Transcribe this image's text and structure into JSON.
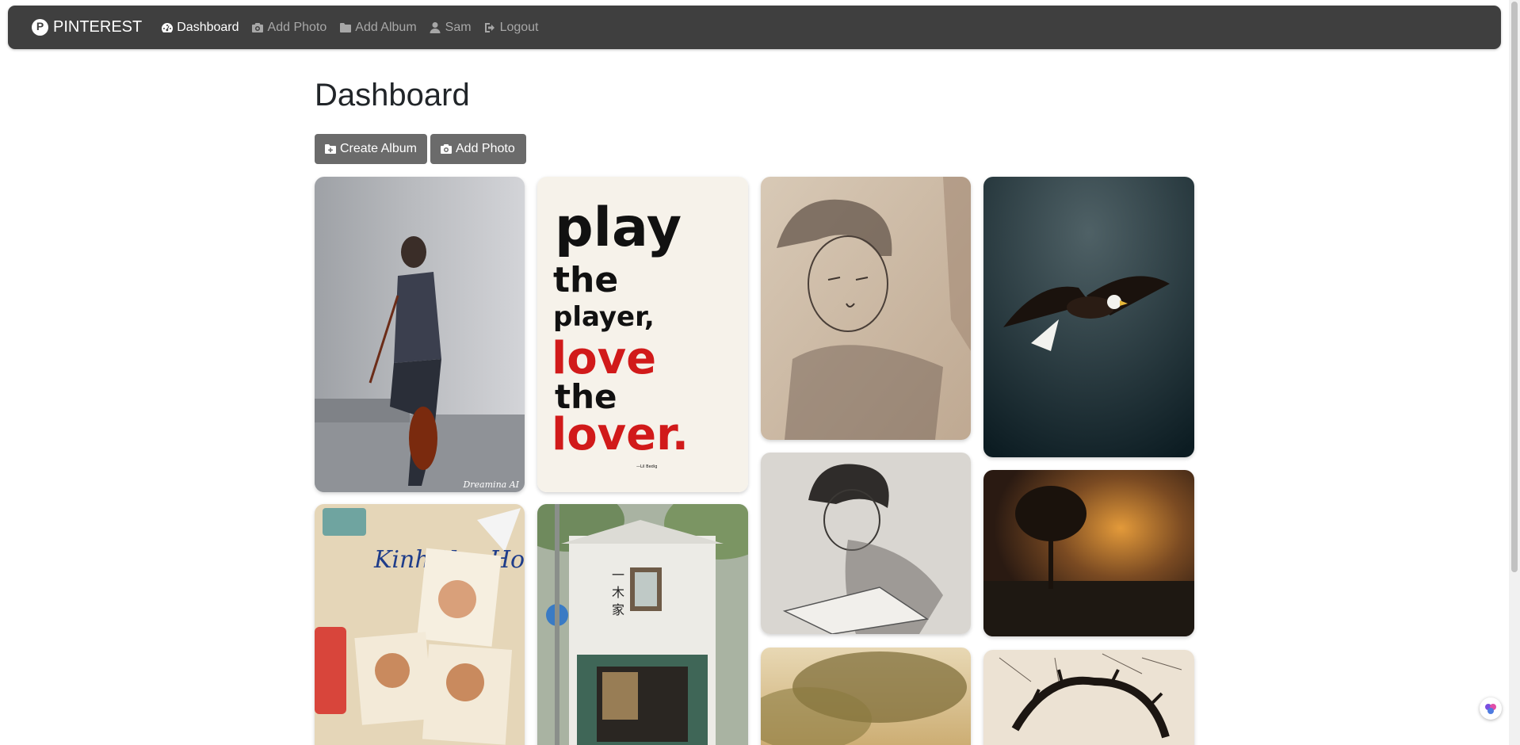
{
  "navbar": {
    "brand": "PINTEREST",
    "items": [
      {
        "label": "Dashboard",
        "icon": "dashboard-icon",
        "active": true
      },
      {
        "label": "Add Photo",
        "icon": "camera-icon",
        "active": false
      },
      {
        "label": "Add Album",
        "icon": "folder-icon",
        "active": false
      },
      {
        "label": "Sam",
        "icon": "user-icon",
        "active": false
      },
      {
        "label": "Logout",
        "icon": "logout-icon",
        "active": false
      }
    ]
  },
  "main": {
    "title": "Dashboard",
    "create_album_label": "Create Album",
    "add_photo_label": "Add Photo"
  },
  "photos": [
    {
      "id": "violinist",
      "watermark": "Dreamina AI"
    },
    {
      "id": "typography-poster",
      "lines": [
        "play",
        "the",
        "player,",
        "love",
        "the",
        "lover."
      ],
      "footer": "—Lil Bedig"
    },
    {
      "id": "sketch-boy"
    },
    {
      "id": "eagle"
    },
    {
      "id": "sketch-reader"
    },
    {
      "id": "tree-sunset"
    },
    {
      "id": "kinh-van-hoa-poster",
      "title": "Kinh Van Hoa"
    },
    {
      "id": "cafe-storefront",
      "sign": [
        "一",
        "木",
        "家"
      ]
    },
    {
      "id": "bokeh-trees"
    },
    {
      "id": "crown-sketch"
    }
  ],
  "colors": {
    "navbar": "#3f3f3f",
    "button": "#6b6b6b",
    "active_nav": "#ffffff",
    "inactive_nav": "#a7a7a7",
    "poster_red": "#d11a1a"
  }
}
